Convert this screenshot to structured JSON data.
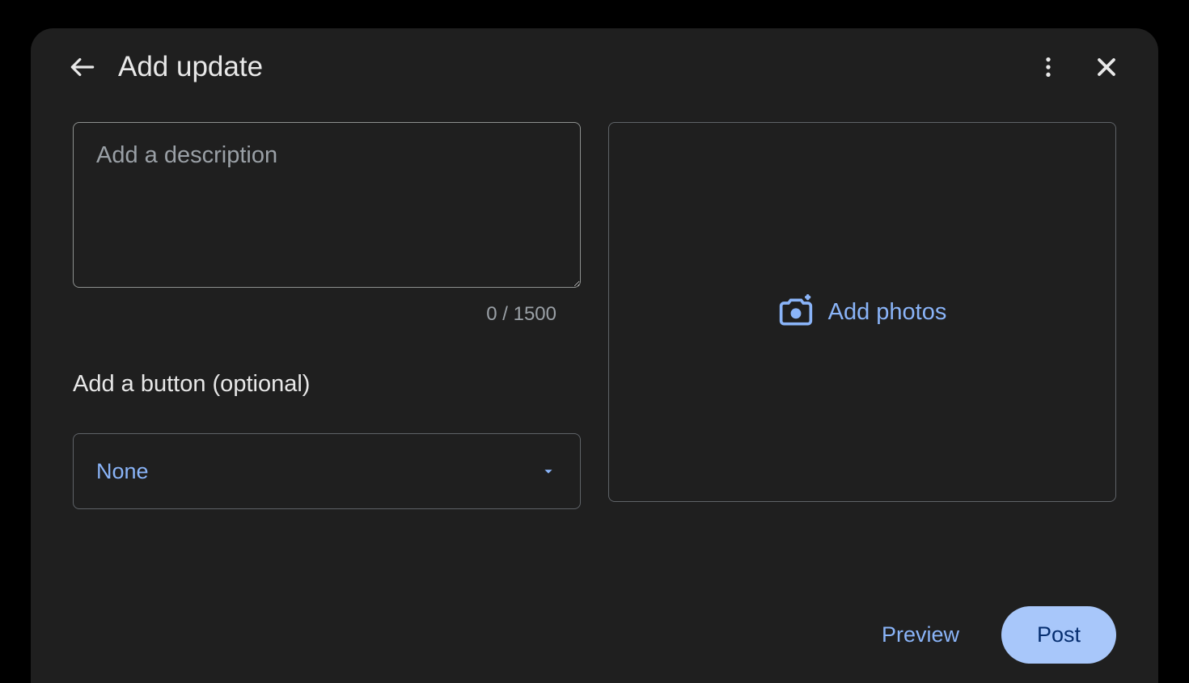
{
  "header": {
    "title": "Add update"
  },
  "description": {
    "placeholder": "Add a description",
    "value": "",
    "counter": "0 / 1500"
  },
  "button_section": {
    "label": "Add a button (optional)",
    "selected_value": "None"
  },
  "photo_section": {
    "label": "Add photos"
  },
  "footer": {
    "preview_label": "Preview",
    "post_label": "Post"
  }
}
